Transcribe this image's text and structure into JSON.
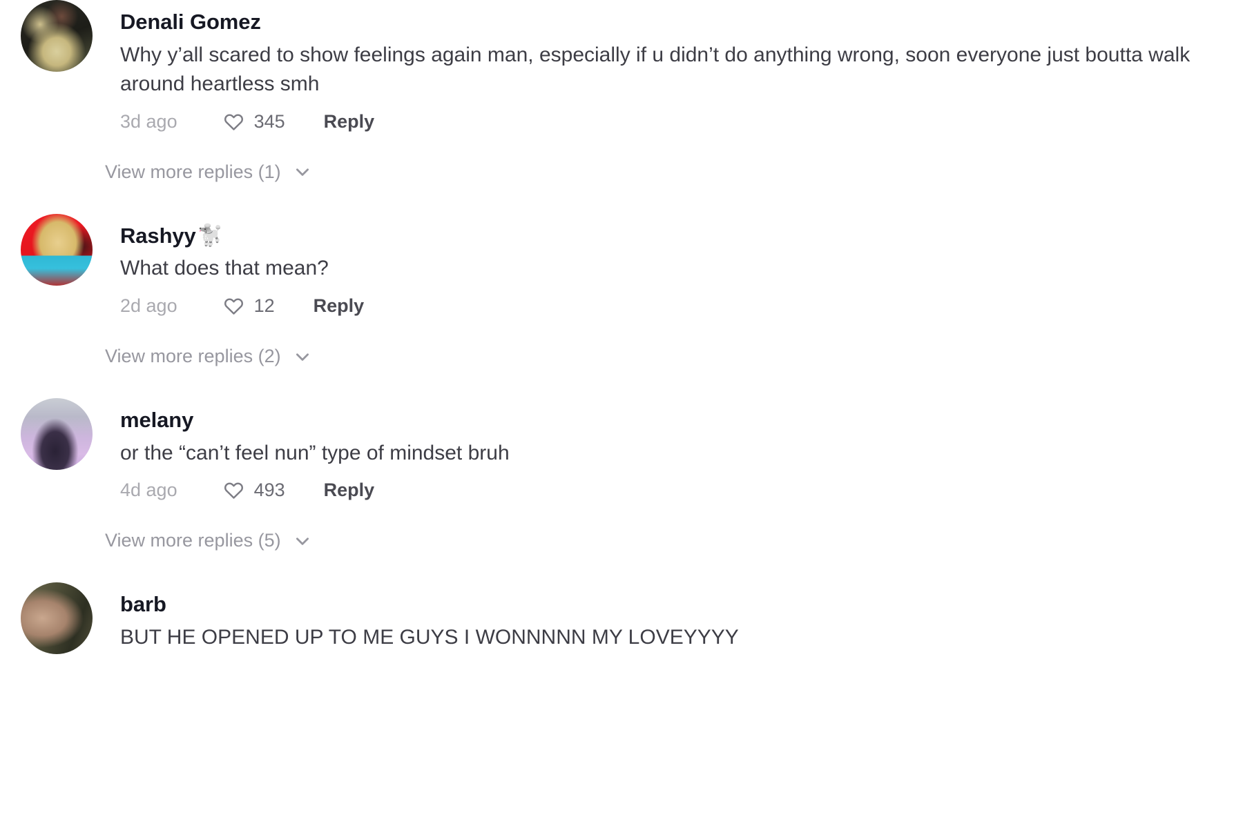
{
  "app": {
    "screen_name": "comment-thread",
    "background": "#ffffff",
    "text_color": "#3d3d45",
    "username_color": "#161823",
    "muted_color": "#a9a9af"
  },
  "icons": {
    "heart": "heart-icon",
    "chevron_down": "chevron-down-icon"
  },
  "labels": {
    "reply": "Reply"
  },
  "comments": [
    {
      "id": "comment-denali-gomez",
      "username": "Denali Gomez",
      "username_emoji": "",
      "text": "Why y’all scared to show feelings again man, especially if u didn’t do anything wrong, soon everyone just boutta walk around heartless smh",
      "time": "3d ago",
      "likes": "345",
      "reply": "Reply",
      "more_replies": "View more replies (1)",
      "avatar_class": "av-denali"
    },
    {
      "id": "comment-rashyy",
      "username": "Rashyy",
      "username_emoji": "🐩",
      "text": "What does that mean?",
      "time": "2d ago",
      "likes": "12",
      "reply": "Reply",
      "more_replies": "View more replies (2)",
      "avatar_class": "av-rashyy"
    },
    {
      "id": "comment-melany",
      "username": "melany",
      "username_emoji": "",
      "text": "or the “can’t feel nun” type of mindset bruh",
      "time": "4d ago",
      "likes": "493",
      "reply": "Reply",
      "more_replies": "View more replies (5)",
      "avatar_class": "av-melany"
    },
    {
      "id": "comment-barb",
      "username": "barb",
      "username_emoji": "",
      "text": "BUT HE OPENED UP TO ME GUYS I WONNNNN MY LOVEYYYY",
      "time": "",
      "likes": "",
      "reply": "",
      "more_replies": "",
      "avatar_class": "av-barb"
    }
  ]
}
